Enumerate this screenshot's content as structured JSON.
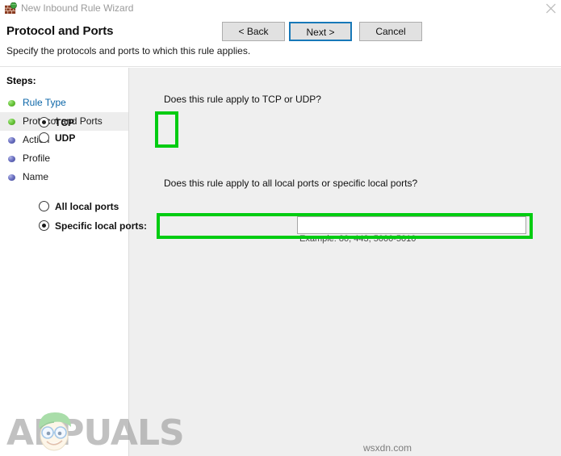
{
  "window": {
    "title": "New Inbound Rule Wizard",
    "icon": "firewall-icon",
    "close_label": "✕"
  },
  "header": {
    "title": "Protocol and Ports",
    "subtitle": "Specify the protocols and ports to which this rule applies."
  },
  "sidebar": {
    "label": "Steps:",
    "items": [
      {
        "label": "Rule Type",
        "state": "done",
        "active": false,
        "link": true
      },
      {
        "label": "Protocol and Ports",
        "state": "done",
        "active": true,
        "link": false
      },
      {
        "label": "Action",
        "state": "todo",
        "active": false,
        "link": false
      },
      {
        "label": "Profile",
        "state": "todo",
        "active": false,
        "link": false
      },
      {
        "label": "Name",
        "state": "todo",
        "active": false,
        "link": false
      }
    ]
  },
  "main": {
    "question_protocol": "Does this rule apply to TCP or UDP?",
    "question_ports": "Does this rule apply to all local ports or specific local ports?",
    "protocol_options": {
      "tcp": {
        "label": "TCP",
        "checked": true
      },
      "udp": {
        "label": "UDP",
        "checked": false
      }
    },
    "port_options": {
      "all": {
        "label": "All local ports",
        "checked": false
      },
      "specific": {
        "label": "Specific local ports:",
        "checked": true
      }
    },
    "ports_value": "",
    "ports_placeholder": "",
    "example_text": "Example: 80, 443, 5000-5010"
  },
  "annotations": {
    "highlight_color": "#00cc11",
    "boxes": [
      {
        "name": "protocol-radio-group",
        "target": "TCP / UDP radio buttons"
      },
      {
        "name": "specific-local-ports-row",
        "target": "Specific local ports row and input"
      }
    ]
  },
  "footer": {
    "back_label": "< Back",
    "next_label": "Next >",
    "cancel_label": "Cancel"
  },
  "watermarks": {
    "brand": "APPUALS",
    "url": "wsxdn.com"
  }
}
